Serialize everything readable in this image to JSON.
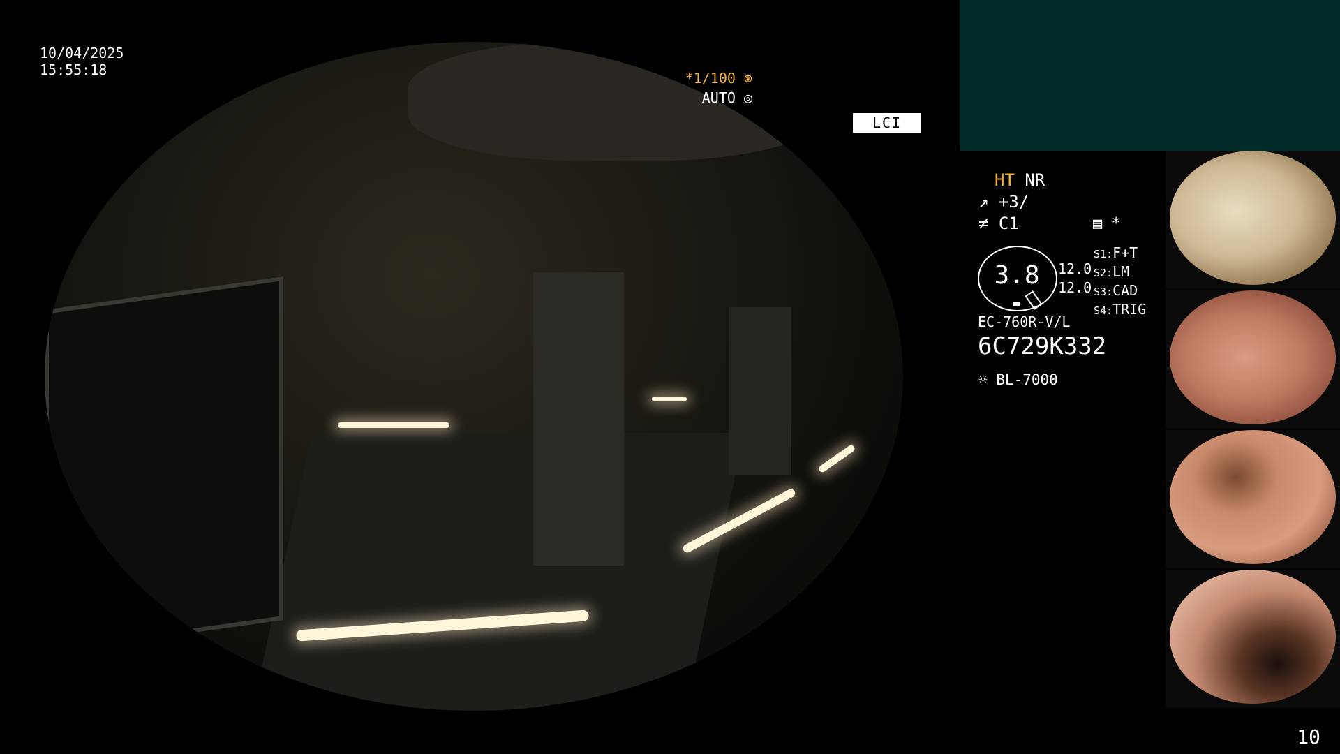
{
  "timestamp": {
    "date": "10/04/2025",
    "time": "15:55:18"
  },
  "overlay": {
    "shutter": "*1/100 ⊛",
    "iris": "AUTO ◎",
    "mode": "LCI"
  },
  "panel": {
    "ht_label": "HT",
    "nr_label": "NR",
    "enhance": "↗ +3/",
    "color": "≠   C1",
    "record": "▤ *",
    "zoom_value": "3.8",
    "values": [
      "12.0",
      "12.0"
    ],
    "slots": [
      {
        "key": "S1:",
        "val": "F+T"
      },
      {
        "key": "S2:",
        "val": "LM"
      },
      {
        "key": "S3:",
        "val": "CAD"
      },
      {
        "key": "S4:",
        "val": "TRIG"
      }
    ],
    "model": "EC-760R-V/L",
    "serial": "6C729K332",
    "lamp": "☼ BL-7000"
  },
  "page_number": "10",
  "colors": {
    "accent": "#f5b43b",
    "teal": "#022c29"
  }
}
